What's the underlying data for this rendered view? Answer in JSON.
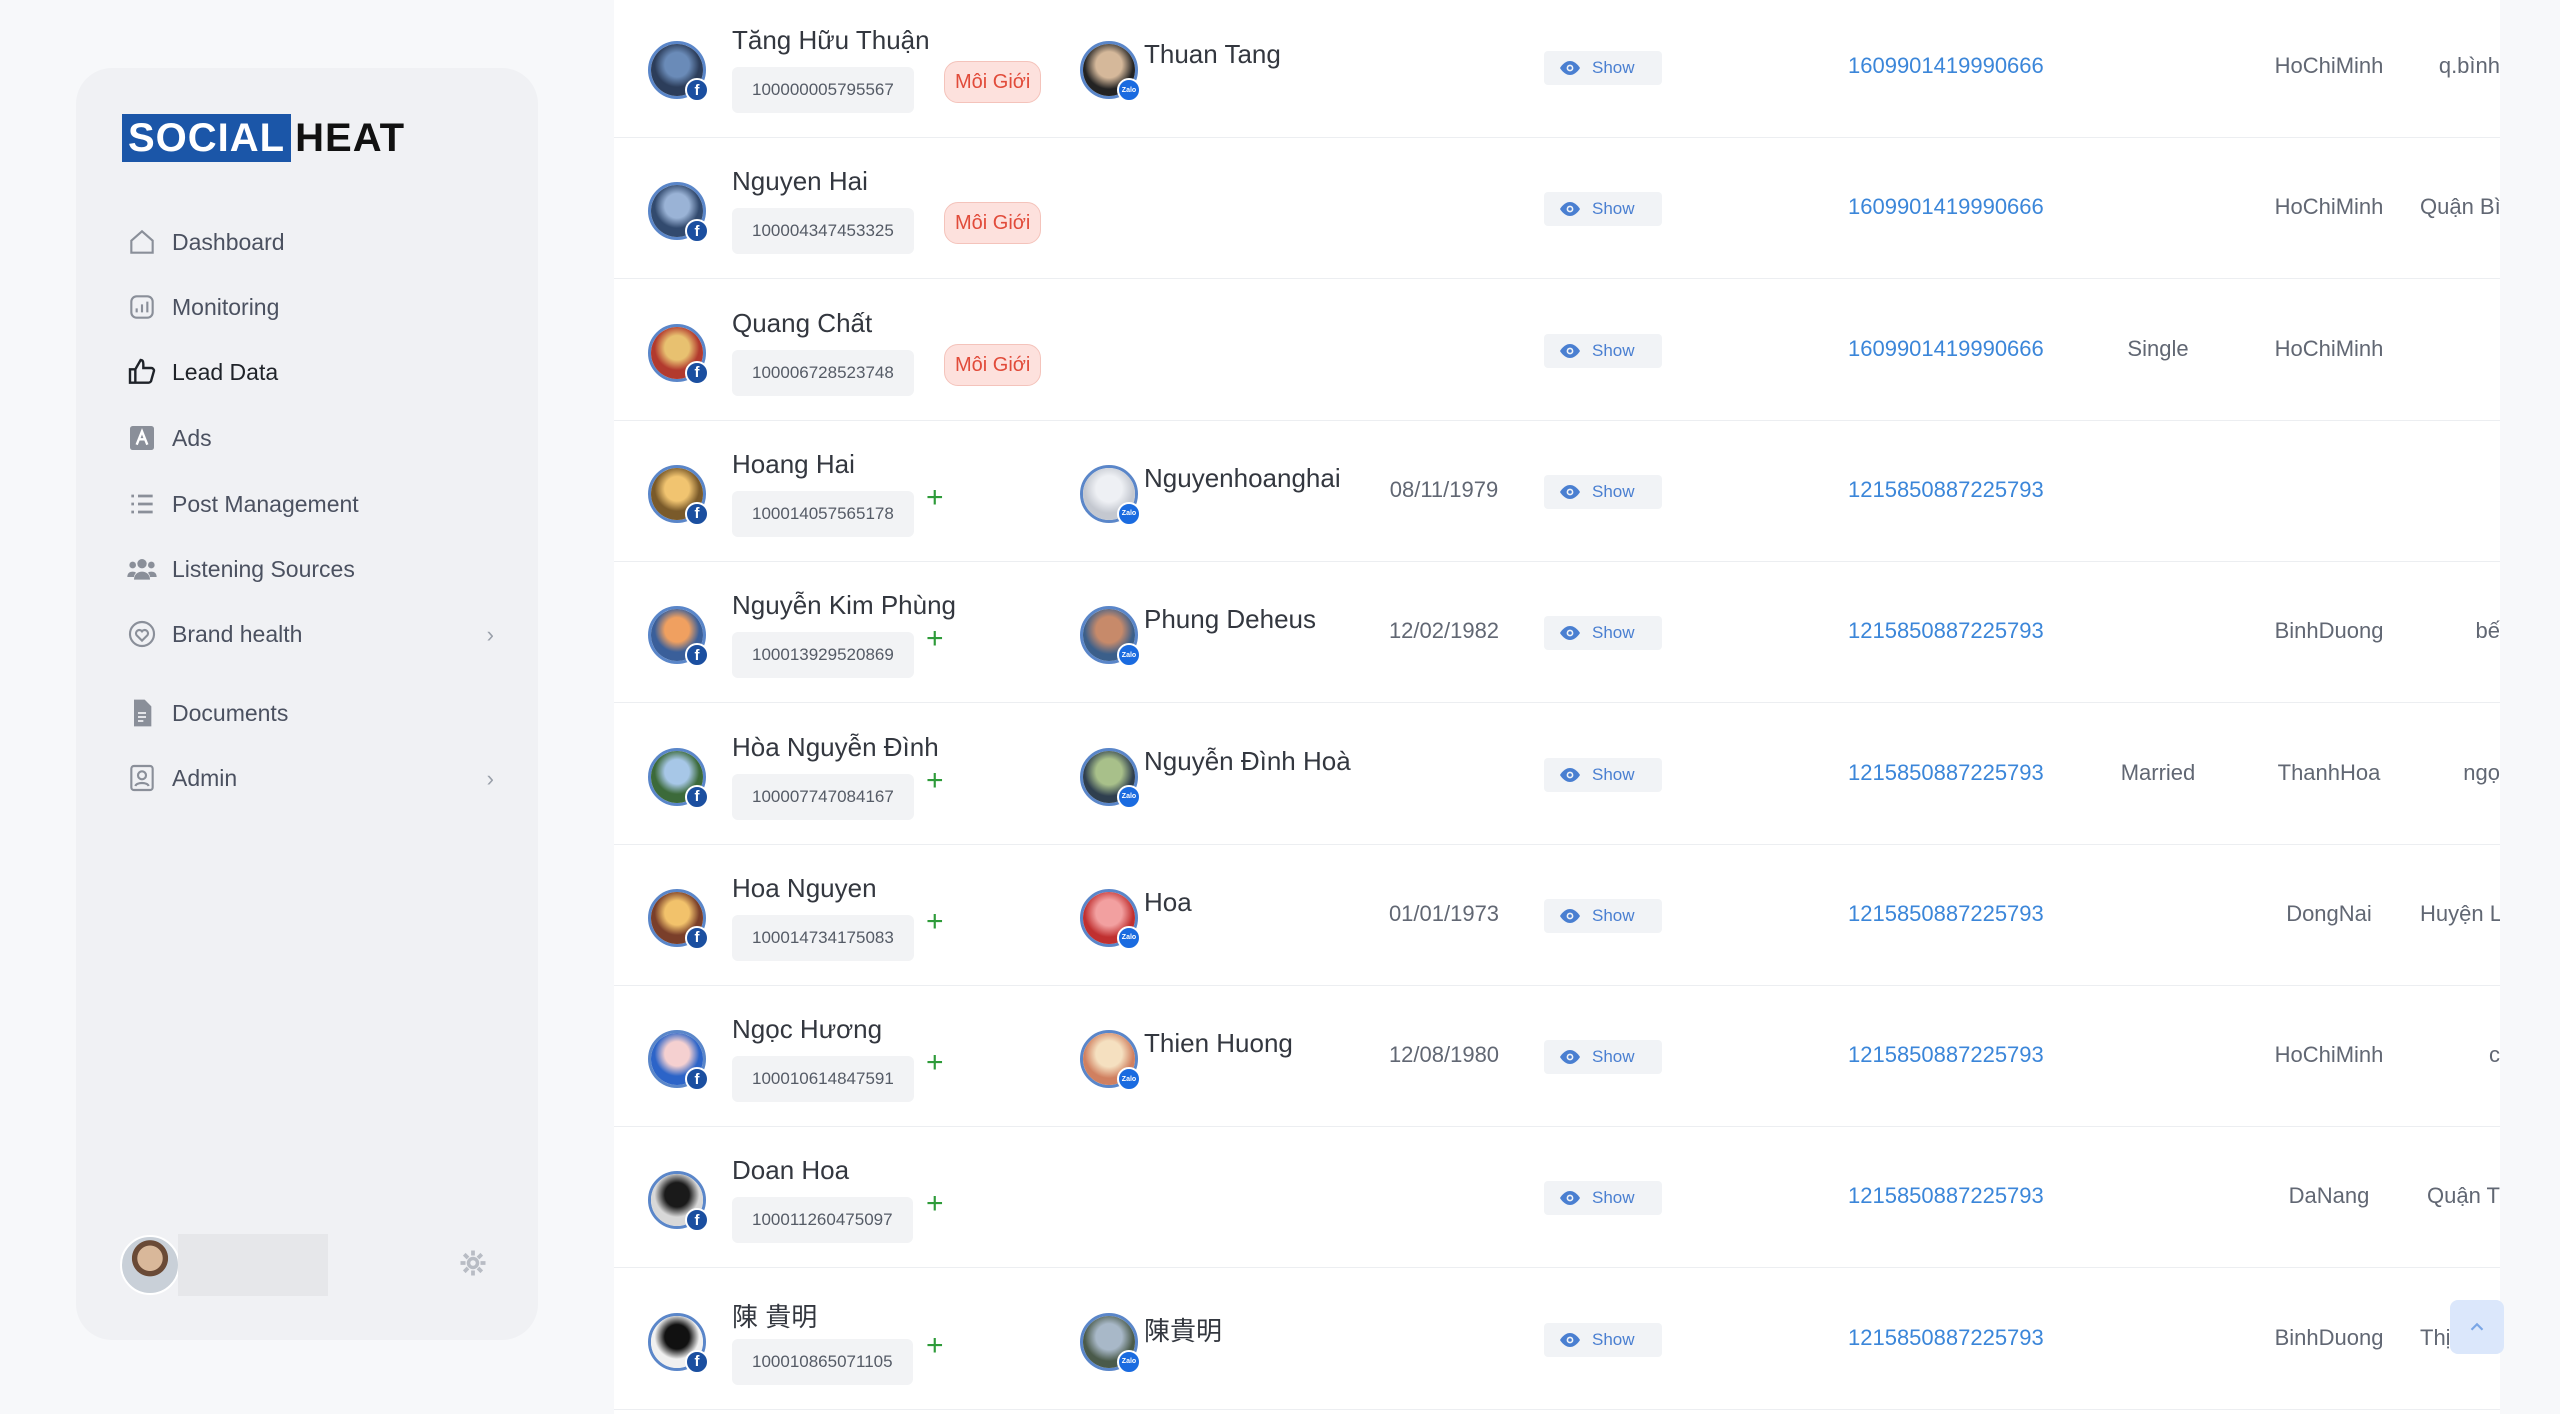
{
  "sidebar": {
    "logo": {
      "part1": "SOCIAL",
      "part2": "HEAT"
    },
    "items": [
      {
        "label": "Dashboard",
        "icon": "home-icon"
      },
      {
        "label": "Monitoring",
        "icon": "chart-icon"
      },
      {
        "label": "Lead Data",
        "icon": "thumbs-up-icon",
        "active": true
      },
      {
        "label": "Ads",
        "icon": "ads-icon"
      },
      {
        "label": "Post Management",
        "icon": "list-icon"
      },
      {
        "label": "Listening Sources",
        "icon": "users-icon"
      },
      {
        "label": "Brand health",
        "icon": "heart-icon",
        "has_children": true
      },
      {
        "label": "Documents",
        "icon": "document-icon"
      },
      {
        "label": "Admin",
        "icon": "admin-icon",
        "has_children": true
      }
    ]
  },
  "table": {
    "show_label": "Show",
    "rows": [
      {
        "name": "Tăng Hữu Thuận",
        "uid": "100000005795567",
        "tag": "Môi Giới",
        "zalo_name": "Thuan Tang",
        "dob": "",
        "phone": "1609901419990666",
        "marital": "",
        "city": "HoChiMinh",
        "district": "q.bình"
      },
      {
        "name": "Nguyen Hai",
        "uid": "100004347453325",
        "tag": "Môi Giới",
        "zalo_name": "",
        "dob": "",
        "phone": "1609901419990666",
        "marital": "",
        "city": "HoChiMinh",
        "district": "Quận Bì"
      },
      {
        "name": "Quang Chất",
        "uid": "100006728523748",
        "tag": "Môi Giới",
        "zalo_name": "",
        "dob": "",
        "phone": "1609901419990666",
        "marital": "Single",
        "city": "HoChiMinh",
        "district": ""
      },
      {
        "name": "Hoang Hai",
        "uid": "100014057565178",
        "tag": "",
        "zalo_name": "Nguyenhoanghai",
        "dob": "08/11/1979",
        "phone": "1215850887225793",
        "marital": "",
        "city": "",
        "district": ""
      },
      {
        "name": "Nguyễn Kim Phùng",
        "uid": "100013929520869",
        "tag": "",
        "zalo_name": "Phung Deheus",
        "dob": "12/02/1982",
        "phone": "1215850887225793",
        "marital": "",
        "city": "BinhDuong",
        "district": "bế"
      },
      {
        "name": "Hòa Nguyễn Đình",
        "uid": "100007747084167",
        "tag": "",
        "zalo_name": "Nguyễn Đình Hoà",
        "dob": "",
        "phone": "1215850887225793",
        "marital": "Married",
        "city": "ThanhHoa",
        "district": "ngọ"
      },
      {
        "name": "Hoa Nguyen",
        "uid": "100014734175083",
        "tag": "",
        "zalo_name": "Hoa",
        "dob": "01/01/1973",
        "phone": "1215850887225793",
        "marital": "",
        "city": "DongNai",
        "district": "Huyện Lo"
      },
      {
        "name": "Ngọc Hương",
        "uid": "100010614847591",
        "tag": "",
        "zalo_name": "Thien Huong",
        "dob": "12/08/1980",
        "phone": "1215850887225793",
        "marital": "",
        "city": "HoChiMinh",
        "district": "c"
      },
      {
        "name": "Doan Hoa",
        "uid": "100011260475097",
        "tag": "",
        "zalo_name": "",
        "dob": "",
        "phone": "1215850887225793",
        "marital": "",
        "city": "DaNang",
        "district": "Quận T"
      },
      {
        "name": "陳 貴明",
        "uid": "100010865071105",
        "tag": "",
        "zalo_name": "陳貴明",
        "dob": "",
        "phone": "1215850887225793",
        "marital": "",
        "city": "BinhDuong",
        "district": "Thị Xã T"
      }
    ]
  },
  "colors": {
    "accent": "#3b86d9",
    "tag_bg": "#fde1dd",
    "tag_text": "#e14b3a",
    "plus": "#2e9b3a",
    "facebook": "#1b4fa0"
  }
}
